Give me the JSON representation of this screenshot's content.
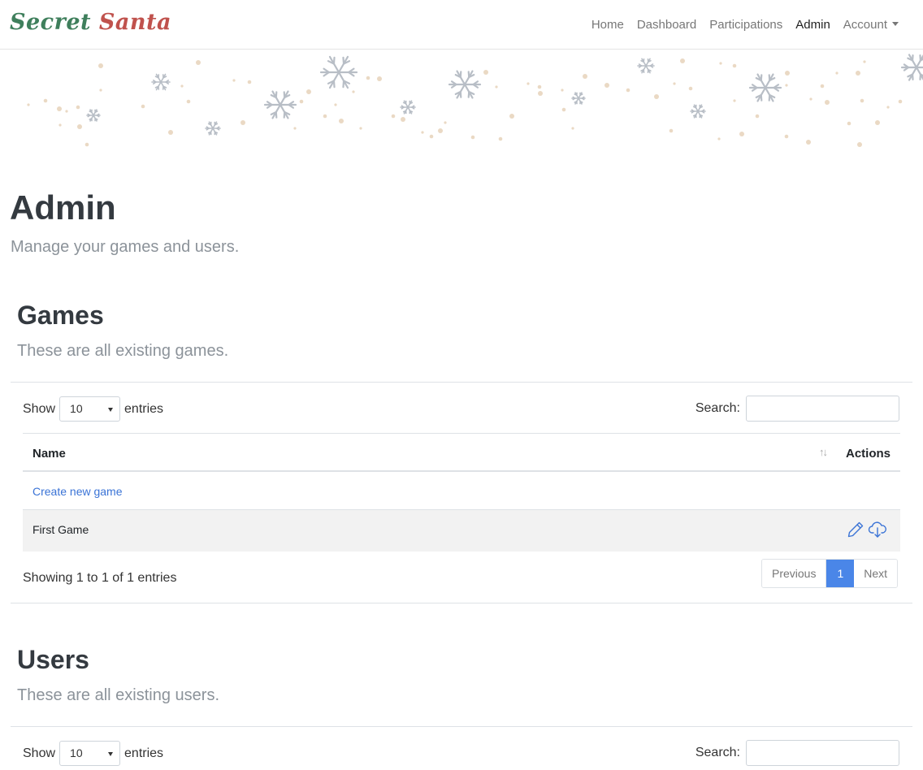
{
  "brand": {
    "word1": "Secret",
    "word2": "Santa"
  },
  "nav": {
    "home": "Home",
    "dashboard": "Dashboard",
    "participations": "Participations",
    "admin": "Admin",
    "account": "Account"
  },
  "page": {
    "title": "Admin",
    "subtitle": "Manage your games and users."
  },
  "games": {
    "title": "Games",
    "subtitle": "These are all existing games.",
    "show_label": "Show",
    "entries_label": "entries",
    "page_length": "10",
    "search_label": "Search:",
    "columns": {
      "name": "Name",
      "actions": "Actions"
    },
    "create_link": "Create new game",
    "rows": [
      {
        "name": "First Game",
        "actions": [
          "pencil-icon",
          "cloud-download-icon"
        ]
      }
    ],
    "info": "Showing 1 to 1 of 1 entries",
    "pagination": {
      "previous": "Previous",
      "current": "1",
      "next": "Next"
    }
  },
  "users": {
    "title": "Users",
    "subtitle": "These are all existing users.",
    "show_label": "Show",
    "entries_label": "entries",
    "page_length": "10",
    "search_label": "Search:"
  },
  "colors": {
    "brand_green": "#3f7f5c",
    "brand_red": "#c0524d",
    "link": "#3a73d6",
    "pagination_active": "#4a86e8",
    "snowflake": "#b8bec6",
    "snow_dot": "#ead9c4"
  }
}
